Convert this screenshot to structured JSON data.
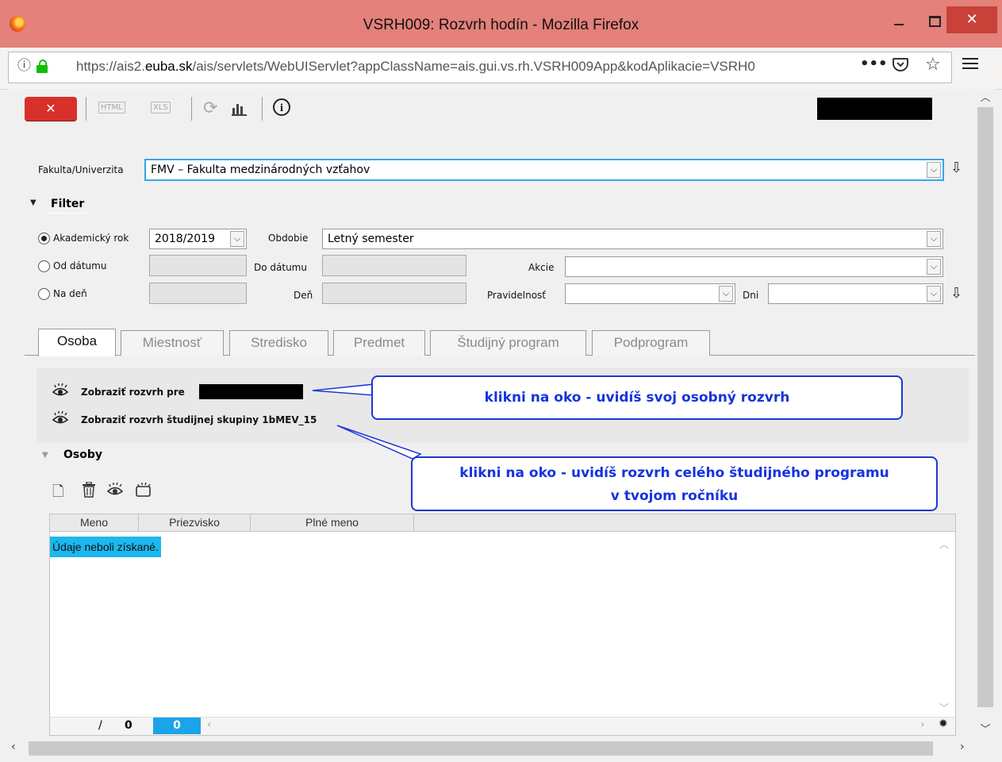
{
  "window": {
    "title": "VSRH009: Rozvrh hodín - Mozilla Firefox",
    "controls": {
      "minimize": "–",
      "maximize": "□",
      "close": "✕"
    }
  },
  "browser": {
    "url_prefix": "https://ais2.",
    "url_domain": "euba.sk",
    "url_rest": "/ais/servlets/WebUIServlet?appClassName=ais.gui.vs.rh.VSRH009App&kodAplikacie=VSRH0",
    "icons": [
      "info-icon",
      "lock-icon",
      "more-icon",
      "pocket-icon",
      "star-icon",
      "menu-icon"
    ]
  },
  "toolbar": {
    "close_label": "✕",
    "html_label": "HTML",
    "xls_label": "XLS",
    "about_label": "i"
  },
  "form": {
    "fakulta_label": "Fakulta/Univerzita",
    "fakulta_value": "FMV – Fakulta medzinárodných vzťahov",
    "filter_label": "Filter",
    "akademicky_rok_label": "Akademický rok",
    "akademicky_rok_value": "2018/2019",
    "obdobie_label": "Obdobie",
    "obdobie_value": "Letný semester",
    "od_datumu_label": "Od dátumu",
    "do_datumu_label": "Do dátumu",
    "akcie_label": "Akcie",
    "na_den_label": "Na deň",
    "den_label": "Deň",
    "pravidelnost_label": "Pravidelnosť",
    "dni_label": "Dni",
    "selected_radio": "akademicky-rok"
  },
  "tabs": [
    {
      "label": "Osoba",
      "active": true
    },
    {
      "label": "Miestnosť",
      "active": false
    },
    {
      "label": "Stredisko",
      "active": false
    },
    {
      "label": "Predmet",
      "active": false
    },
    {
      "label": "Študijný program",
      "active": false
    },
    {
      "label": "Podprogram",
      "active": false
    }
  ],
  "osoba": {
    "show_personal": "Zobraziť rozvrh pre",
    "show_group": "Zobraziť rozvrh študijnej skupiny 1bMEV_15",
    "callout1": "klikni na oko - uvidíš svoj osobný rozvrh",
    "callout2_line1": "klikni na oko - uvidíš rozvrh celého študijného programu",
    "callout2_line2": "v tvojom ročníku",
    "osoby_label": "Osoby"
  },
  "grid": {
    "columns": [
      "Meno",
      "Priezvisko",
      "Plné meno"
    ],
    "empty_message": "Údaje neboli získané.",
    "pager_sep": "/",
    "pager_total": "0",
    "pager_current": "0"
  },
  "colors": {
    "titlebar": "#e3817a",
    "accent_blue": "#1bb7ee",
    "callout": "#1533e0",
    "close_red": "#d8302b"
  }
}
